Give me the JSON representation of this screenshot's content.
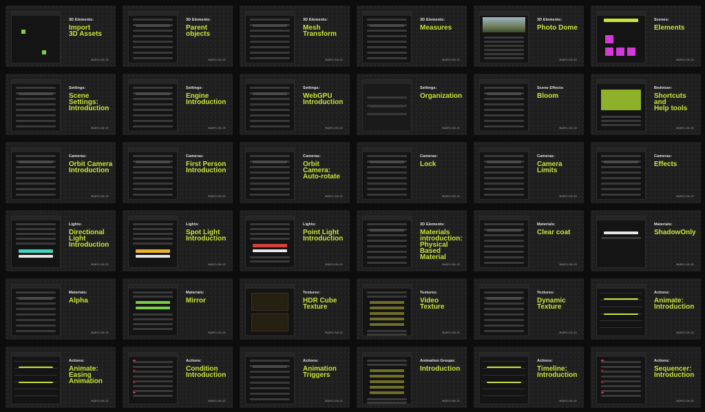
{
  "brand": "BABYLON.JS",
  "accent": "#c7e63a",
  "cards": [
    {
      "category": "3D Elements:",
      "title": "Import\n3D Assets",
      "thumb": "import"
    },
    {
      "category": "3D Elements:",
      "title": "Parent\nobjects",
      "thumb": "panel"
    },
    {
      "category": "3D Elements:",
      "title": "Mesh\nTransform",
      "thumb": "panel"
    },
    {
      "category": "3D Elements:",
      "title": "Measures",
      "thumb": "panel"
    },
    {
      "category": "3D Elements:",
      "title": "Photo Dome",
      "thumb": "photo"
    },
    {
      "category": "Scenes:",
      "title": "Elements",
      "thumb": "elements"
    },
    {
      "category": "Settings:",
      "title": "Scene\nSettings:\nIntroduction",
      "thumb": "panel"
    },
    {
      "category": "Settings:",
      "title": "Engine\nIntroduction",
      "thumb": "panel"
    },
    {
      "category": "Settings:",
      "title": "WebGPU\nIntroduction",
      "thumb": "panel"
    },
    {
      "category": "Settings:",
      "title": "Organization",
      "thumb": "settings"
    },
    {
      "category": "Scene Effects:",
      "title": "Bloom",
      "thumb": "panel"
    },
    {
      "category": "Bedvisor:",
      "title": "Shortcuts\nand\nHelp tools",
      "thumb": "shortcuts"
    },
    {
      "category": "Cameras:",
      "title": "Orbit Camera\nIntroduction",
      "thumb": "panel"
    },
    {
      "category": "Cameras:",
      "title": "First Person\nIntroduction",
      "thumb": "panel"
    },
    {
      "category": "Cameras:",
      "title": "Orbit Camera:\nAuto-rotate",
      "thumb": "panel"
    },
    {
      "category": "Cameras:",
      "title": "Lock",
      "thumb": "panel"
    },
    {
      "category": "Cameras:",
      "title": "Camera\nLimits",
      "thumb": "panel"
    },
    {
      "category": "Cameras:",
      "title": "Effects",
      "thumb": "panel"
    },
    {
      "category": "Lights:",
      "title": "Directional\nLight\nIntroduction",
      "thumb": "dirlight"
    },
    {
      "category": "Lights:",
      "title": "Spot Light\nIntroduction",
      "thumb": "spotlight"
    },
    {
      "category": "Lights:",
      "title": "Point Light\nIntroduction",
      "thumb": "pointlight"
    },
    {
      "category": "3D Elements:",
      "title": "Materials\nintroduction:\nPhysical\nBased\nMaterial",
      "thumb": "panel"
    },
    {
      "category": "Materials:",
      "title": "Clear coat",
      "thumb": "panel"
    },
    {
      "category": "Materials:",
      "title": "ShadowOnly",
      "thumb": "shadow"
    },
    {
      "category": "Materials:",
      "title": "Alpha",
      "thumb": "panel"
    },
    {
      "category": "Materials:",
      "title": "Mirror",
      "thumb": "mirror"
    },
    {
      "category": "Textures:",
      "title": "HDR Cube\nTexture",
      "thumb": "hdr"
    },
    {
      "category": "Textures:",
      "title": "Video\nTexture",
      "thumb": "video"
    },
    {
      "category": "Textures:",
      "title": "Dynamic\nTexture",
      "thumb": "panel"
    },
    {
      "category": "Actions:",
      "title": "Animate:\nIntroduction",
      "thumb": "timeline"
    },
    {
      "category": "Actions:",
      "title": "Animate:\nEasing\nAnimation",
      "thumb": "timeline"
    },
    {
      "category": "Actions:",
      "title": "Condition\nIntroduction",
      "thumb": "condition"
    },
    {
      "category": "Actions:",
      "title": "Animation\nTriggers",
      "thumb": "panel"
    },
    {
      "category": "Animation Groups:",
      "title": "Introduction",
      "thumb": "video"
    },
    {
      "category": "Actions:",
      "title": "Timeline:\nIntroduction",
      "thumb": "timeline"
    },
    {
      "category": "Actions:",
      "title": "Sequencer:\nIntroduction",
      "thumb": "condition"
    }
  ]
}
